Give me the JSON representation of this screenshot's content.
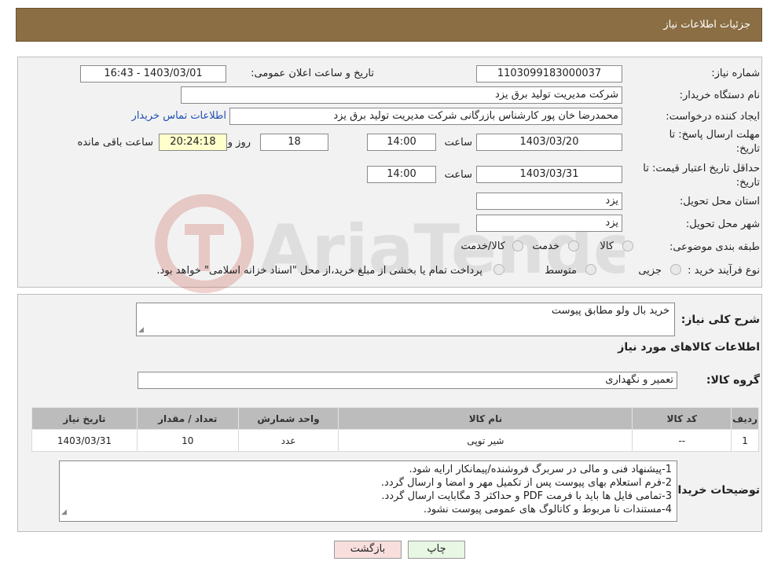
{
  "header": {
    "title": "جزئیات اطلاعات نیاز"
  },
  "form": {
    "need_number_label": "شماره نیاز:",
    "need_number": "1103099183000037",
    "announce_label": "تاریخ و ساعت اعلان عمومی:",
    "announce_value": "1403/03/01 - 16:43",
    "buyer_org_label": "نام دستگاه خریدار:",
    "buyer_org": "شرکت مدیریت تولید برق یزد",
    "requester_label": "ایجاد کننده درخواست:",
    "requester": "محمدرضا خان پور کارشناس بازرگانی شرکت مدیریت تولید برق یزد",
    "contact_link": "اطلاعات تماس خریدار",
    "deadline_label_1": "مهلت ارسال پاسخ: تا",
    "deadline_label_2": "تاریخ:",
    "deadline_date": "1403/03/20",
    "hour_label": "ساعت",
    "deadline_time": "14:00",
    "days_value": "18",
    "days_label": "روز و",
    "remaining_time": "20:24:18",
    "remaining_label": "ساعت باقی مانده",
    "validity_label_1": "حداقل تاریخ اعتبار قیمت: تا",
    "validity_label_2": "تاریخ:",
    "validity_date": "1403/03/31",
    "validity_time": "14:00",
    "province_label": "استان محل تحویل:",
    "province": "یزد",
    "city_label": "شهر محل تحویل:",
    "city": "یزد",
    "category_label": "طبقه بندی موضوعی:",
    "category_options": [
      "کالا",
      "خدمت",
      "کالا/خدمت"
    ],
    "process_label": "نوع فرآیند خرید :",
    "process_options": [
      "جزیی",
      "متوسط"
    ],
    "process_note": "پرداخت تمام یا بخشی از مبلغ خرید،از محل \"اسناد خزانه اسلامی\" خواهد بود."
  },
  "details": {
    "summary_label": "شرح کلی نیاز:",
    "summary": "خرید بال ولو مطابق پیوست",
    "goods_info_title": "اطلاعات کالاهای مورد نیاز",
    "goods_group_label": "گروه کالا:",
    "goods_group": "تعمیر و نگهداری",
    "table": {
      "headers": [
        "ردیف",
        "کد کالا",
        "نام کالا",
        "واحد شمارش",
        "تعداد / مقدار",
        "تاریخ نیاز"
      ],
      "rows": [
        [
          "1",
          "--",
          "شیر توپی",
          "عدد",
          "10",
          "1403/03/31"
        ]
      ]
    },
    "buyer_notes_label": "توضیحات خریدار:",
    "buyer_notes": [
      "1-پیشنهاد فنی و مالی در سربرگ فروشنده/پیمانکار ارایه شود.",
      "2-فرم استعلام بهای پیوست پس از تکمیل مهر و امضا و ارسال گردد.",
      "3-تمامی فایل ها باید با فرمت PDF و حداکثر 3 مگابایت ارسال گردد.",
      "4-مستندات نا مربوط و کاتالوگ های عمومی پیوست نشود."
    ]
  },
  "buttons": {
    "print": "چاپ",
    "back": "بازگشت"
  },
  "watermark": {
    "text": "AriaTender.neT"
  },
  "colors": {
    "header_bg": "#8b6e44",
    "back_button_bg": "#f9dede",
    "print_button_bg": "#e8f6e4",
    "link": "#1f4fb5"
  }
}
